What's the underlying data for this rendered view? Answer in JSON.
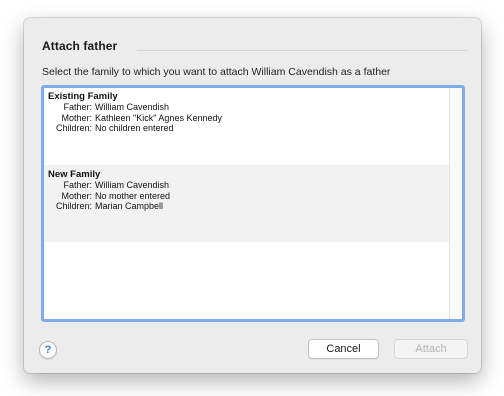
{
  "dialog": {
    "title": "Attach father",
    "instruction": "Select the family to which you want to attach William Cavendish as a father"
  },
  "families": [
    {
      "heading": "Existing Family",
      "father_label": "Father:",
      "father": "William Cavendish",
      "mother_label": "Mother:",
      "mother": "Kathleen \"Kick\" Agnes Kennedy",
      "children_label": "Children:",
      "children": "No children entered"
    },
    {
      "heading": "New Family",
      "father_label": "Father:",
      "father": "William Cavendish",
      "mother_label": "Mother:",
      "mother": "No mother entered",
      "children_label": "Children:",
      "children": "Marian Campbell"
    }
  ],
  "buttons": {
    "help": "?",
    "cancel": "Cancel",
    "attach": "Attach"
  },
  "colors": {
    "focus_ring": "#7fabe6",
    "dialog_bg": "#ececec",
    "alt_row": "#f2f2f2",
    "disabled_text": "#b5b5b5",
    "help_icon": "#3a7ad9"
  },
  "state": {
    "attach_enabled": false
  }
}
